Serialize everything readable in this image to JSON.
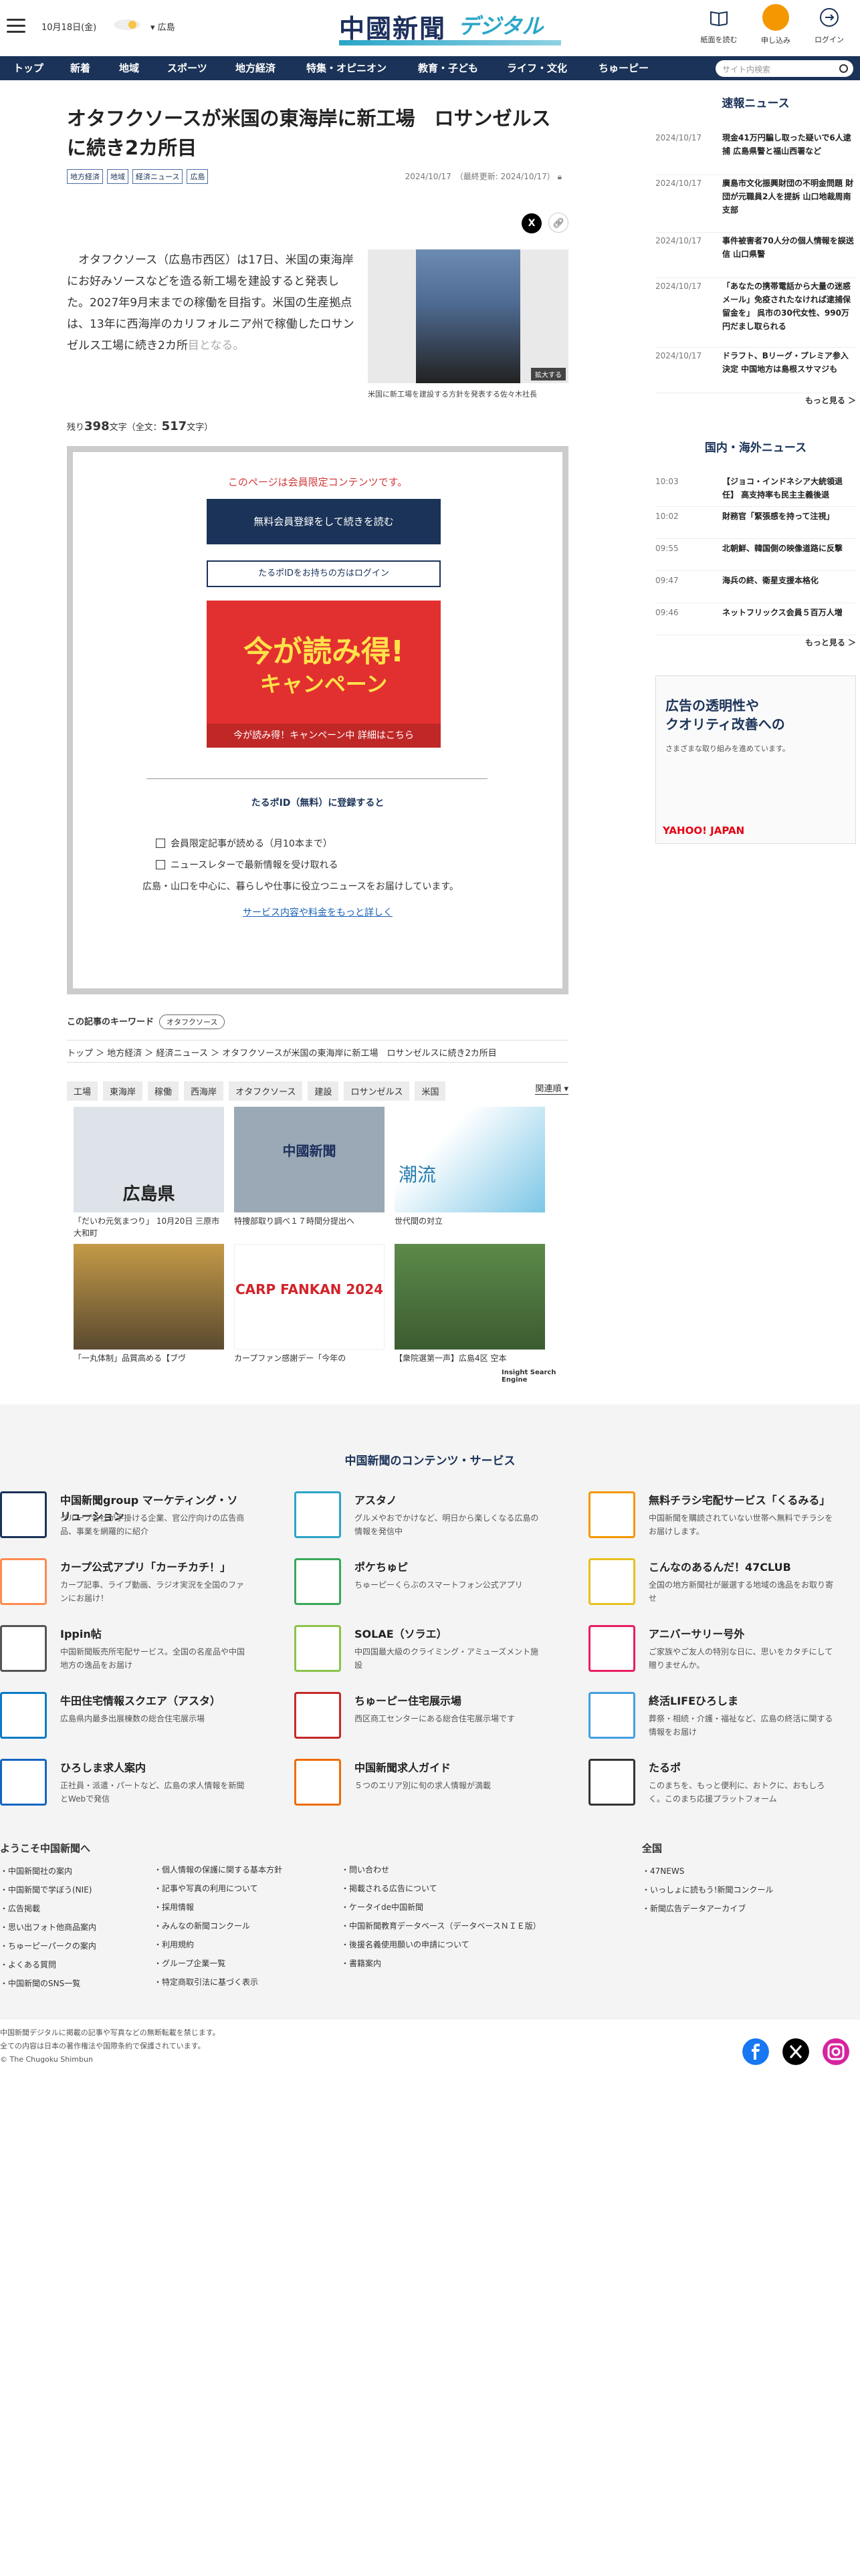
{
  "header": {
    "date": "10月18日(金)",
    "region": "広島",
    "logo_main": "中國新聞",
    "logo_sub": "デジタル",
    "buttons": [
      {
        "label": "紙面を読む"
      },
      {
        "label": "申し込み"
      },
      {
        "label": "ログイン"
      }
    ]
  },
  "nav": {
    "items": [
      "トップ",
      "新着",
      "地域",
      "スポーツ",
      "地方経済",
      "特集・オピニオン",
      "教育・子ども",
      "ライフ・文化",
      "ちゅーピー"
    ],
    "search_placeholder": "サイト内検索"
  },
  "article": {
    "title": "オタフクソースが米国の東海岸に新工場　ロサンゼルスに続き2カ所目",
    "tags": [
      "地方経済",
      "地域",
      "経済ニュース",
      "広島"
    ],
    "updated": "2024/10/17　（最終更新: 2024/10/17）",
    "lead": "　オタフクソース（広島市西区）は17日、米国の東海岸にお好みソースなどを造る新工場を建設すると発表した。2027年9月末までの稼働を目指す。米国の生産拠点は、13年に西海岸のカリフォルニア州で稼働したロサンゼルス工場に続き2カ所",
    "lead_fade": "目となる。",
    "photo_caption": "米国に新工場を建設する方針を発表する佐々木社長",
    "zoom_label": "拡大する",
    "remain_prefix": "残り",
    "remain_count": "398",
    "remain_mid": "文字（全文：",
    "remain_total": "517",
    "remain_suffix": "文字）"
  },
  "paywall": {
    "message": "このページは会員限定コンテンツです。",
    "register": "無料会員登録をして続きを読む",
    "login": "たるポIDをお持ちの方はログイン",
    "banner_title": "今が読み得!",
    "banner_sub": "キャンペーン",
    "banner_strip": "今が読み得！キャンペーン中 詳細はこちら",
    "heading": "たるポID（無料）に登録すると",
    "benefits": [
      "会員限定記事が読める（月10本まで）",
      "ニュースレターで最新情報を受け取れる"
    ],
    "note": "広島・山口を中心に、暮らしや仕事に役立つニュースをお届けしています。",
    "more": "サービス内容や料金をもっと詳しく"
  },
  "keywords": {
    "label": "この記事のキーワード",
    "items": [
      "オタフクソース"
    ]
  },
  "breadcrumb": "トップ ＞ 地方経済 ＞ 経済ニュース ＞ オタフクソースが米国の東海岸に新工場　ロサンゼルスに続き2カ所目",
  "categories": [
    "工場",
    "東海岸",
    "稼働",
    "西海岸",
    "オタフクソース",
    "建設",
    "ロサンゼルス",
    "米国"
  ],
  "sort_label": "関連順",
  "related": [
    {
      "title": "「だいわ元気まつり」 10月20日 三原市大和町",
      "img": "広島県"
    },
    {
      "title": "特捜部取り調べ１７時間分提出へ",
      "img": "中國新聞"
    },
    {
      "title": "世代間の対立",
      "img": "潮流"
    },
    {
      "title": "「一丸体制」品質高める【ブヴ",
      "img": ""
    },
    {
      "title": "カープファン感謝デー「今年の",
      "img": "CARP FANKAN 2024"
    },
    {
      "title": "【衆院選第一声】広島4区 空本",
      "img": ""
    }
  ],
  "ise_label": "Insight Search Engine",
  "sidebar": {
    "news_heading": "速報ニュース",
    "news": [
      {
        "date": "2024/10/17",
        "title": "現金41万円騙し取った疑いで6人逮捕 広島県警と福山西署など"
      },
      {
        "date": "2024/10/17",
        "title": "廣島市文化振興財団の不明金問題 財団が元職員2人を提訴 山口地裁周南支部"
      },
      {
        "date": "2024/10/17",
        "title": "事件被害者70人分の個人情報を誤送信 山口県警"
      },
      {
        "date": "2024/10/17",
        "title": "「あなたの携帯電話から大量の迷惑メール」免疫されたなければ逮捕保留金を」 呉市の30代女性、990万円だまし取られる"
      },
      {
        "date": "2024/10/17",
        "title": "ドラフト、Bリーグ・プレミア参入決定 中国地方は島根スサマジも"
      }
    ],
    "more1": "もっと見る ＞",
    "world_heading": "国内・海外ニュース",
    "world": [
      {
        "date": "10:03",
        "title": "【ジョコ・インドネシア大統領退任】 高支持率も民主主義後退"
      },
      {
        "date": "10:02",
        "title": "財務官「緊張感を持って注視」"
      },
      {
        "date": "09:55",
        "title": "北朝鮮、韓国側の映像道路に反撃"
      },
      {
        "date": "09:47",
        "title": "海兵の終、衛星支援本格化"
      },
      {
        "date": "09:46",
        "title": "ネットフリックス会員５百万人増"
      }
    ],
    "more2": "もっと見る ＞",
    "ad_line1": "広告の透明性や",
    "ad_line2": "クオリティ改善への",
    "ad_note": "さまざまな取り組みを進めています。",
    "ad_brand": "YAHOO! JAPAN"
  },
  "footer": {
    "heading": "中国新聞のコンテンツ・サービス",
    "services": [
      {
        "name": "中国新聞group マーケティング・ソリューション",
        "desc": "グループ各社が手掛ける企業、官公庁向けの広告商品、事業を網羅的に紹介"
      },
      {
        "name": "アスタノ",
        "desc": "グルメやおでかけなど、明日から楽しくなる広島の情報を発信中"
      },
      {
        "name": "無料チラシ宅配サービス「くるみる」",
        "desc": "中国新聞を購読されていない世帯へ無料でチラシをお届けします。"
      },
      {
        "name": "カープ公式アプリ「カーチカチ！」",
        "desc": "カープ記事、ライブ動画、ラジオ実況を全国のファンにお届け！"
      },
      {
        "name": "ポケちゅピ",
        "desc": "ちゅーピーくらぶのスマートフォン公式アプリ"
      },
      {
        "name": "こんなのあるんだ！47CLUB",
        "desc": "全国の地方新聞社が厳選する地域の逸品をお取り寄せ"
      },
      {
        "name": "Ippin帖",
        "desc": "中国新聞販売所宅配サービス。全国の名産品や中国地方の逸品をお届け"
      },
      {
        "name": "SOLAE（ソラエ）",
        "desc": "中四国最大級のクライミング・アミューズメント施設"
      },
      {
        "name": "アニバーサリー号外",
        "desc": "ご家族やご友人の特別な日に、思いをカタチにして贈りませんか。"
      },
      {
        "name": "牛田住宅情報スクエア（アスタ）",
        "desc": "広島県内最多出展棟数の総合住宅展示場"
      },
      {
        "name": "ちゅーピー住宅展示場",
        "desc": "西区商工センターにある総合住宅展示場です"
      },
      {
        "name": "終活LIFEひろしま",
        "desc": "葬祭・相続・介護・福祉など、広島の終活に関する情報をお届け"
      },
      {
        "name": "ひろしま求人案内",
        "desc": "正社員・派遣・パートなど、広島の求人情報を新聞とWebで発信"
      },
      {
        "name": "中国新聞求人ガイド",
        "desc": "５つのエリア別に旬の求人情報が満載"
      },
      {
        "name": "たるポ",
        "desc": "このまちを、もっと便利に、おトクに、おもしろく。このまち応援プラットフォーム"
      }
    ],
    "links_heading": "ようこそ中国新聞へ",
    "col1": [
      "中国新聞社の案内",
      "中国新聞で学ぼう(NIE)",
      "広告掲載",
      "思い出フォト他商品案内",
      "ちゅーピーパークの案内",
      "よくある質問",
      "中国新聞のSNS一覧"
    ],
    "col2": [
      "個人情報の保護に関する基本方針",
      "記事や写真の利用について",
      "採用情報",
      "みんなの新聞コンクール",
      "利用規約",
      "グループ企業一覧",
      "特定商取引法に基づく表示"
    ],
    "col3": [
      "問い合わせ",
      "掲載される広告について",
      "ケータイde中国新聞",
      "中国新聞教育データベース（データベースＮＩＥ版）",
      "後援名義使用願いの申請について",
      "書籍案内"
    ],
    "zenkoku_heading": "全国",
    "col4": [
      "47NEWS",
      "いっしょに読もう!新聞コンクール",
      "新聞広告データアーカイブ"
    ],
    "copy1": "中国新聞デジタルに掲載の記事や写真などの無断転載を禁じます。",
    "copy2": "全ての内容は日本の著作権法や国際条約で保護されています。",
    "copy3": "© The Chugoku Shimbun"
  },
  "colors": {
    "navy": "#1b3358",
    "accent": "#2aa6c8",
    "orange": "#f39800",
    "red": "#d23a3a"
  }
}
